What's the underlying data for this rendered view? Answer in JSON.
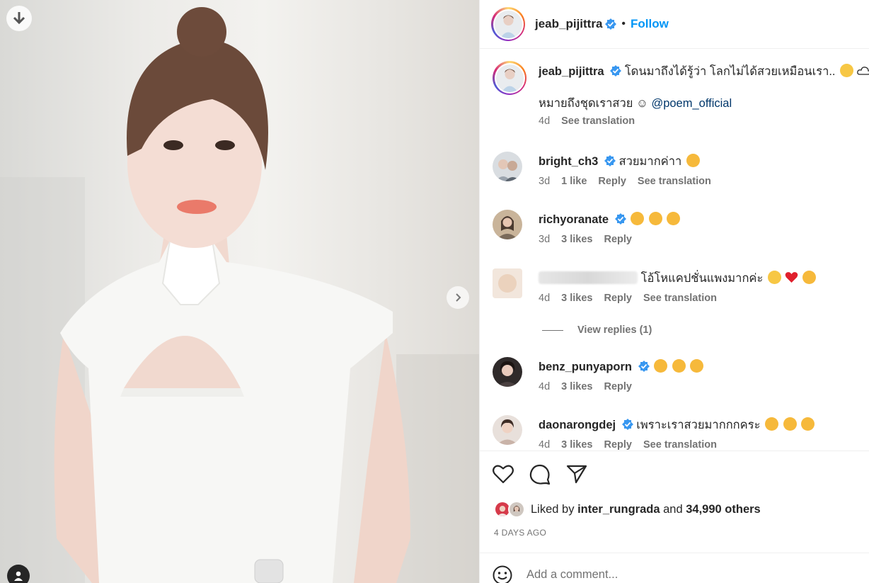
{
  "post": {
    "username": "jeab_pijittra",
    "follow_label": "Follow",
    "separator": "•"
  },
  "caption": {
    "username": "jeab_pijittra",
    "text_line1": "โดนมาถึงได้รู้ว่า โลกไม่ได้สวยเหมือนเรา..",
    "text_line2": "หมายถึงชุดเราสวย ☺",
    "mention": "@poem_official",
    "age": "4d",
    "see_translation": "See translation"
  },
  "comments": [
    {
      "username": "bright_ch3",
      "text": "สวยมากค่าา",
      "age": "3d",
      "likes": "1 like",
      "reply": "Reply",
      "see_translation": "See translation"
    },
    {
      "username": "richyoranate",
      "text": "",
      "age": "3d",
      "likes": "3 likes",
      "reply": "Reply"
    },
    {
      "username": "",
      "text": "โอ้โหแคปชั่นแพงมากค่ะ",
      "age": "4d",
      "likes": "3 likes",
      "reply": "Reply",
      "see_translation": "See translation",
      "view_replies": "View replies (1)"
    },
    {
      "username": "benz_punyaporn",
      "text": "",
      "age": "4d",
      "likes": "3 likes",
      "reply": "Reply"
    },
    {
      "username": "daonarongdej",
      "text": "เพราะเราสวยมากกกคระ",
      "age": "4d",
      "likes": "3 likes",
      "reply": "Reply",
      "see_translation": "See translation"
    }
  ],
  "likes_line": {
    "prefix": "Liked by",
    "user": "inter_rungrada",
    "conj": "and",
    "others": "34,990 others"
  },
  "time_ago": "4 DAYS AGO",
  "add_comment_placeholder": "Add a comment...",
  "colors": {
    "accent": "#0095f6",
    "verified": "#3897f0",
    "text": "#262626",
    "muted": "#737373"
  },
  "icons": [
    "download-icon",
    "chevron-right-icon",
    "user-tag-icon",
    "verified-badge-icon",
    "heart-icon",
    "comment-icon",
    "share-icon",
    "emoji-icon"
  ]
}
